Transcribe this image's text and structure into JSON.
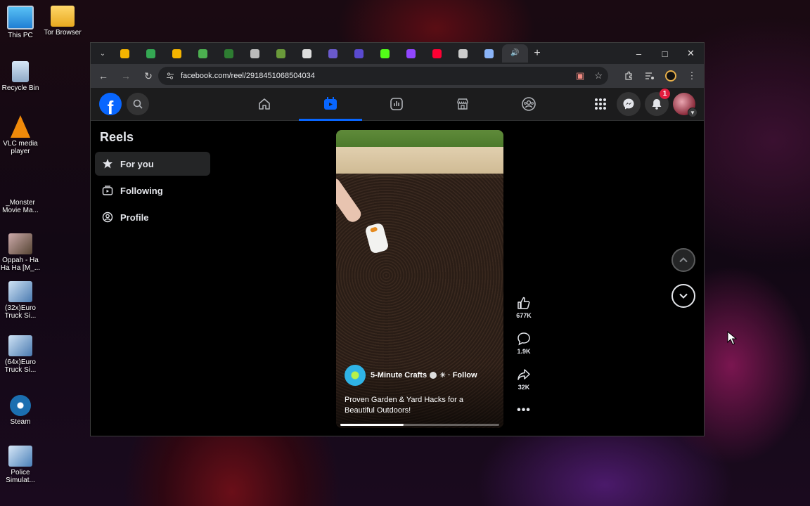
{
  "desktop": {
    "icons": [
      {
        "label": "This PC",
        "icon": "monitor-icon",
        "color": "#3aa0e8"
      },
      {
        "label": "Tor Browser",
        "icon": "folder-icon",
        "color": "#f4c64d"
      },
      {
        "label": "Recycle Bin",
        "icon": "recycle-bin-icon",
        "color": "#9fb8d6"
      },
      {
        "label": "VLC media player",
        "icon": "vlc-cone-icon",
        "color": "#f08a0a"
      },
      {
        "label": "_Monster Movie Ma...",
        "icon": "generic-file-icon",
        "color": "#333333"
      },
      {
        "label": "Oppah - Ha Ha Ha [M_...",
        "icon": "video-file-icon",
        "color": "#7a5a4a"
      },
      {
        "label": "(32x)Euro Truck Si...",
        "icon": "truck-game-icon",
        "color": "#8ab0d8"
      },
      {
        "label": "(64x)Euro Truck Si...",
        "icon": "truck-game-icon",
        "color": "#8ab0d8"
      },
      {
        "label": "Steam",
        "icon": "steam-icon",
        "color": "#1b6fb0"
      },
      {
        "label": "Police Simulat...",
        "icon": "police-game-icon",
        "color": "#6aa0d0"
      }
    ]
  },
  "browser": {
    "tabs": [
      {
        "icon": "google-drive-icon",
        "color": "#f4b400"
      },
      {
        "icon": "google-drive-icon",
        "color": "#34a853"
      },
      {
        "icon": "google-drive-icon",
        "color": "#f4b400"
      },
      {
        "icon": "green-circle-icon",
        "color": "#4caf50"
      },
      {
        "icon": "st-icon",
        "color": "#2e7d32"
      },
      {
        "icon": "globe-icon",
        "color": "#bbbbbb"
      },
      {
        "icon": "leaf-icon",
        "color": "#6a9a3a"
      },
      {
        "icon": "document-icon",
        "color": "#dddddd"
      },
      {
        "icon": "person-icon",
        "color": "#6a5acd"
      },
      {
        "icon": "shield-icon",
        "color": "#5a4ad0"
      },
      {
        "icon": "kick-icon",
        "color": "#53fc18"
      },
      {
        "icon": "twitch-icon",
        "color": "#9146ff"
      },
      {
        "icon": "youtube-icon",
        "color": "#ff0033"
      },
      {
        "icon": "sparkle-icon",
        "color": "#cccccc"
      },
      {
        "icon": "search-tab-icon",
        "color": "#8ab4f8"
      },
      {
        "icon": "speaker-icon",
        "color": "#dddddd",
        "active": true
      }
    ],
    "url": "facebook.com/reel/2918451068504034"
  },
  "facebook": {
    "logo_letter": "f",
    "notification_count": "1",
    "sidebar": {
      "title": "Reels",
      "items": [
        {
          "label": "For you",
          "icon": "star-icon",
          "active": true
        },
        {
          "label": "Following",
          "icon": "following-icon"
        },
        {
          "label": "Profile",
          "icon": "profile-icon"
        }
      ]
    },
    "reel": {
      "author": "5-Minute Crafts",
      "follow_label": "Follow",
      "caption_line1": "Proven Garden & Yard Hacks for a",
      "caption_line2": "Beautiful Outdoors!",
      "progress": 0.4
    },
    "actions": {
      "likes": "677K",
      "comments": "1.9K",
      "shares": "32K"
    },
    "colors": {
      "brand": "#0866ff",
      "background": "#000000",
      "topbar": "#1c1c1d",
      "badge": "#e41e3f"
    }
  }
}
